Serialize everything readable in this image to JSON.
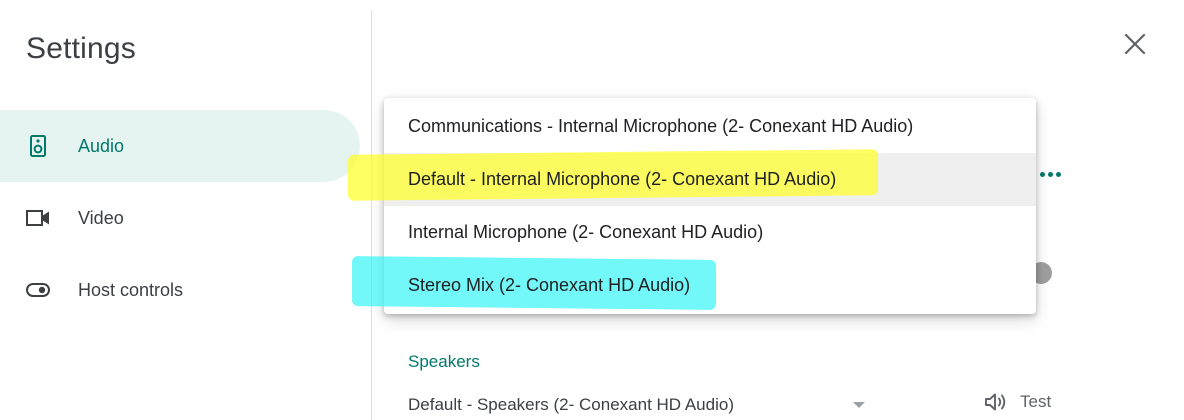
{
  "settings": {
    "title": "Settings"
  },
  "sidebar": {
    "items": [
      {
        "label": "Audio",
        "icon": "speaker-icon",
        "active": true
      },
      {
        "label": "Video",
        "icon": "videocam-icon",
        "active": false
      },
      {
        "label": "Host controls",
        "icon": "toggle-icon",
        "active": false
      }
    ]
  },
  "dropdown": {
    "options": [
      {
        "label": "Communications - Internal Microphone (2- Conexant HD Audio)",
        "selected": false
      },
      {
        "label": "Default - Internal Microphone (2- Conexant HD Audio)",
        "selected": true
      },
      {
        "label": "Internal Microphone (2- Conexant HD Audio)",
        "selected": false
      },
      {
        "label": "Stereo Mix (2- Conexant HD Audio)",
        "selected": false
      }
    ]
  },
  "speakers": {
    "label": "Speakers",
    "selected": "Default - Speakers (2- Conexant HD Audio)",
    "test_label": "Test"
  },
  "colors": {
    "accent": "#00796b",
    "active_bg": "#e6f4f1",
    "highlight_yellow": "#ffff28",
    "highlight_cyan": "#3cf5f5"
  }
}
